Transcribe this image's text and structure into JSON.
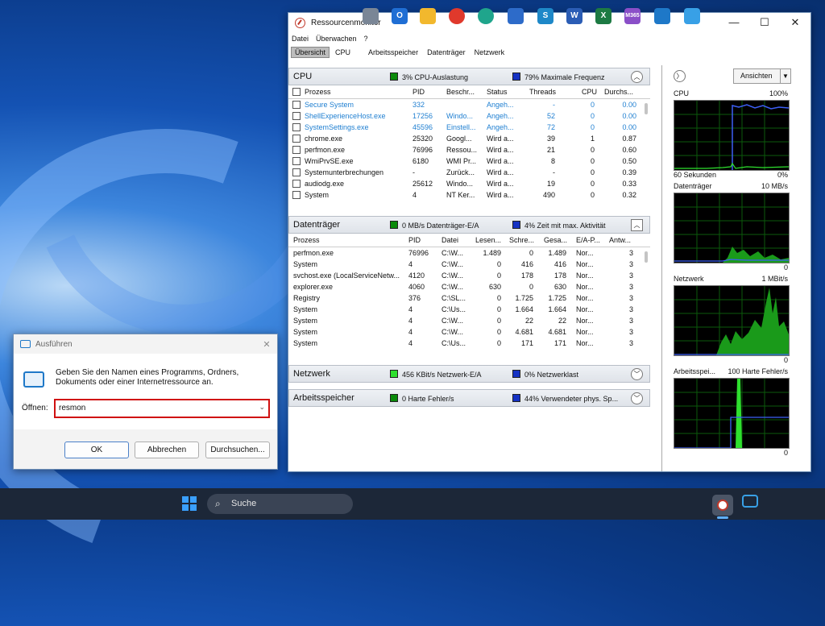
{
  "resmon": {
    "title": "Ressourcenmonitor",
    "window_buttons": {
      "minimize": "—",
      "maximize": "☐",
      "close": "✕"
    },
    "menu": [
      "Datei",
      "Überwachen",
      "?"
    ],
    "tabs": [
      "Übersicht",
      "CPU",
      "Arbeitsspeicher",
      "Datenträger",
      "Netzwerk"
    ],
    "cpu": {
      "title": "CPU",
      "info1": "3% CPU-Auslastung",
      "info2": "79% Maximale Frequenz",
      "headers": [
        "Prozess",
        "PID",
        "Beschr...",
        "Status",
        "Threads",
        "CPU",
        "Durchs..."
      ],
      "rows": [
        {
          "name": "Secure System",
          "pid": "332",
          "desc": "",
          "status": "Angeh...",
          "threads": "-",
          "cpu": "0",
          "avg": "0.00",
          "blue": true
        },
        {
          "name": "ShellExperienceHost.exe",
          "pid": "17256",
          "desc": "Windo...",
          "status": "Angeh...",
          "threads": "52",
          "cpu": "0",
          "avg": "0.00",
          "blue": true
        },
        {
          "name": "SystemSettings.exe",
          "pid": "45596",
          "desc": "Einstell...",
          "status": "Angeh...",
          "threads": "72",
          "cpu": "0",
          "avg": "0.00",
          "blue": true
        },
        {
          "name": "chrome.exe",
          "pid": "25320",
          "desc": "Googl...",
          "status": "Wird a...",
          "threads": "39",
          "cpu": "1",
          "avg": "0.87",
          "blue": false
        },
        {
          "name": "perfmon.exe",
          "pid": "76996",
          "desc": "Ressou...",
          "status": "Wird a...",
          "threads": "21",
          "cpu": "0",
          "avg": "0.60",
          "blue": false
        },
        {
          "name": "WmiPrvSE.exe",
          "pid": "6180",
          "desc": "WMI Pr...",
          "status": "Wird a...",
          "threads": "8",
          "cpu": "0",
          "avg": "0.50",
          "blue": false
        },
        {
          "name": "Systemunterbrechungen",
          "pid": "-",
          "desc": "Zurück...",
          "status": "Wird a...",
          "threads": "-",
          "cpu": "0",
          "avg": "0.39",
          "blue": false
        },
        {
          "name": "audiodg.exe",
          "pid": "25612",
          "desc": "Windo...",
          "status": "Wird a...",
          "threads": "19",
          "cpu": "0",
          "avg": "0.33",
          "blue": false
        },
        {
          "name": "System",
          "pid": "4",
          "desc": "NT Ker...",
          "status": "Wird a...",
          "threads": "490",
          "cpu": "0",
          "avg": "0.32",
          "blue": false
        }
      ]
    },
    "disk": {
      "title": "Datenträger",
      "info1": "0 MB/s Datenträger-E/A",
      "info2": "4% Zeit mit max. Aktivität",
      "headers": [
        "Prozess",
        "PID",
        "Datei",
        "Lesen...",
        "Schre...",
        "Gesa...",
        "E/A-P...",
        "Antw..."
      ],
      "rows": [
        {
          "name": "perfmon.exe",
          "pid": "76996",
          "file": "C:\\W...",
          "read": "1.489",
          "write": "0",
          "total": "1.489",
          "prio": "Nor...",
          "resp": "3"
        },
        {
          "name": "System",
          "pid": "4",
          "file": "C:\\W...",
          "read": "0",
          "write": "416",
          "total": "416",
          "prio": "Nor...",
          "resp": "3"
        },
        {
          "name": "svchost.exe (LocalServiceNetw...",
          "pid": "4120",
          "file": "C:\\W...",
          "read": "0",
          "write": "178",
          "total": "178",
          "prio": "Nor...",
          "resp": "3"
        },
        {
          "name": "explorer.exe",
          "pid": "4060",
          "file": "C:\\W...",
          "read": "630",
          "write": "0",
          "total": "630",
          "prio": "Nor...",
          "resp": "3"
        },
        {
          "name": "Registry",
          "pid": "376",
          "file": "C:\\SL...",
          "read": "0",
          "write": "1.725",
          "total": "1.725",
          "prio": "Nor...",
          "resp": "3"
        },
        {
          "name": "System",
          "pid": "4",
          "file": "C:\\Us...",
          "read": "0",
          "write": "1.664",
          "total": "1.664",
          "prio": "Nor...",
          "resp": "3"
        },
        {
          "name": "System",
          "pid": "4",
          "file": "C:\\W...",
          "read": "0",
          "write": "22",
          "total": "22",
          "prio": "Nor...",
          "resp": "3"
        },
        {
          "name": "System",
          "pid": "4",
          "file": "C:\\W...",
          "read": "0",
          "write": "4.681",
          "total": "4.681",
          "prio": "Nor...",
          "resp": "3"
        },
        {
          "name": "System",
          "pid": "4",
          "file": "C:\\Us...",
          "read": "0",
          "write": "171",
          "total": "171",
          "prio": "Nor...",
          "resp": "3"
        }
      ]
    },
    "network": {
      "title": "Netzwerk",
      "info1": "456 KBit/s Netzwerk-E/A",
      "info2": "0% Netzwerklast"
    },
    "memory": {
      "title": "Arbeitsspeicher",
      "info1": "0 Harte Fehler/s",
      "info2": "44% Verwendeter phys. Sp..."
    },
    "graphs": {
      "views_button": "Ansichten",
      "cpu": {
        "name": "CPU",
        "max": "100%",
        "footer_left": "60 Sekunden",
        "footer_right": "0%"
      },
      "disk": {
        "name": "Datenträger",
        "max": "10 MB/s",
        "min": "0"
      },
      "net": {
        "name": "Netzwerk",
        "max": "1 MBit/s",
        "min": "0"
      },
      "mem": {
        "name": "Arbeitsspei...",
        "max": "100 Harte Fehler/s",
        "min": "0"
      }
    }
  },
  "run": {
    "title": "Ausführen",
    "description": "Geben Sie den Namen eines Programms, Ordners, Dokuments oder einer Internetressource an.",
    "open_label": "Öffnen:",
    "value": "resmon",
    "ok": "OK",
    "cancel": "Abbrechen",
    "browse": "Durchsuchen..."
  },
  "taskbar": {
    "search": "Suche"
  }
}
